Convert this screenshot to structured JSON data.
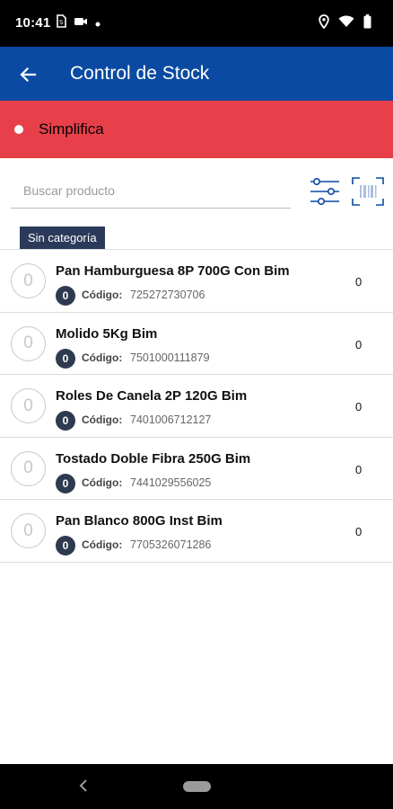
{
  "status_bar": {
    "time": "10:41",
    "left_icons": [
      "sim-icon",
      "video-icon",
      "notification-dot-icon"
    ],
    "right_icons": [
      "location-icon",
      "wifi-icon",
      "battery-icon"
    ]
  },
  "app_bar": {
    "title": "Control de Stock",
    "back_icon": "arrow-back-icon"
  },
  "company": {
    "name": "Simplifica",
    "color": "#e8404a"
  },
  "search": {
    "placeholder": "Buscar producto",
    "value": ""
  },
  "toolbar": {
    "filter_icon": "sliders-icon",
    "barcode_icon": "barcode-scan-icon"
  },
  "category": {
    "label": "Sin categoría"
  },
  "products": [
    {
      "qty": "0",
      "name": "Pan Hamburguesa 8P 700G Con Bim",
      "badge": "0",
      "code_label": "Código:",
      "code": "725272730706",
      "stock": "0"
    },
    {
      "qty": "0",
      "name": "Molido 5Kg Bim",
      "badge": "0",
      "code_label": "Código:",
      "code": "7501000111879",
      "stock": "0"
    },
    {
      "qty": "0",
      "name": "Roles De Canela 2P 120G Bim",
      "badge": "0",
      "code_label": "Código:",
      "code": "7401006712127",
      "stock": "0"
    },
    {
      "qty": "0",
      "name": "Tostado Doble Fibra 250G Bim",
      "badge": "0",
      "code_label": "Código:",
      "code": "7441029556025",
      "stock": "0"
    },
    {
      "qty": "0",
      "name": "Pan Blanco 800G Inst Bim",
      "badge": "0",
      "code_label": "Código:",
      "code": "7705326071286",
      "stock": "0"
    }
  ],
  "colors": {
    "app_bar": "#0b4aa2",
    "company_bar": "#e8404a",
    "chip": "#2b3a5a",
    "accent_icon": "#0b4aa2"
  }
}
